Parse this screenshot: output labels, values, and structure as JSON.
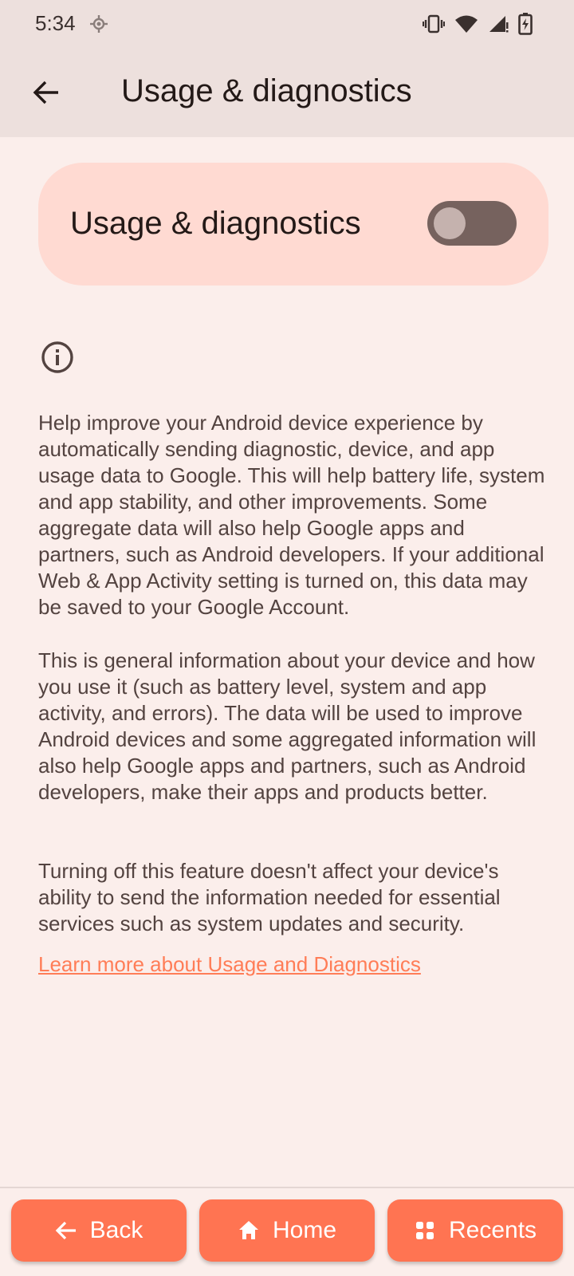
{
  "status_bar": {
    "time": "5:34",
    "icons": [
      "location-icon",
      "vibrate-icon",
      "wifi-icon",
      "signal-icon",
      "battery-charging-icon"
    ]
  },
  "app_bar": {
    "back_icon": "arrow-back-icon",
    "title": "Usage & diagnostics"
  },
  "toggle": {
    "label": "Usage & diagnostics",
    "state": "off"
  },
  "info_icon": "info-icon",
  "paragraphs": [
    "Help improve your Android device experience by automatically sending diagnostic, device, and app usage data to Google. This will help battery life, system and app stability, and other improvements. Some aggregate data will also help Google apps and partners, such as Android developers. If your additional Web & App Activity setting is turned on, this data may be saved to your Google Account.",
    "This is general information about your device and how you use it (such as battery level, system and app activity, and errors). The data will be used to improve Android devices and some aggregated information will also help Google apps and partners, such as Android developers, make their apps and products better.",
    "Turning off this feature doesn't affect your device's ability to send the information needed for essential services such as system updates and security."
  ],
  "learn_more_link": "Learn more about Usage and Diagnostics",
  "nav": {
    "back": "Back",
    "home": "Home",
    "recents": "Recents"
  },
  "colors": {
    "background": "#FBEEEB",
    "app_bar": "#EDE0DD",
    "card": "#FFDAD2",
    "switch_track": "#76625E",
    "link": "#FF7D57",
    "nav_button": "#FF7452"
  }
}
